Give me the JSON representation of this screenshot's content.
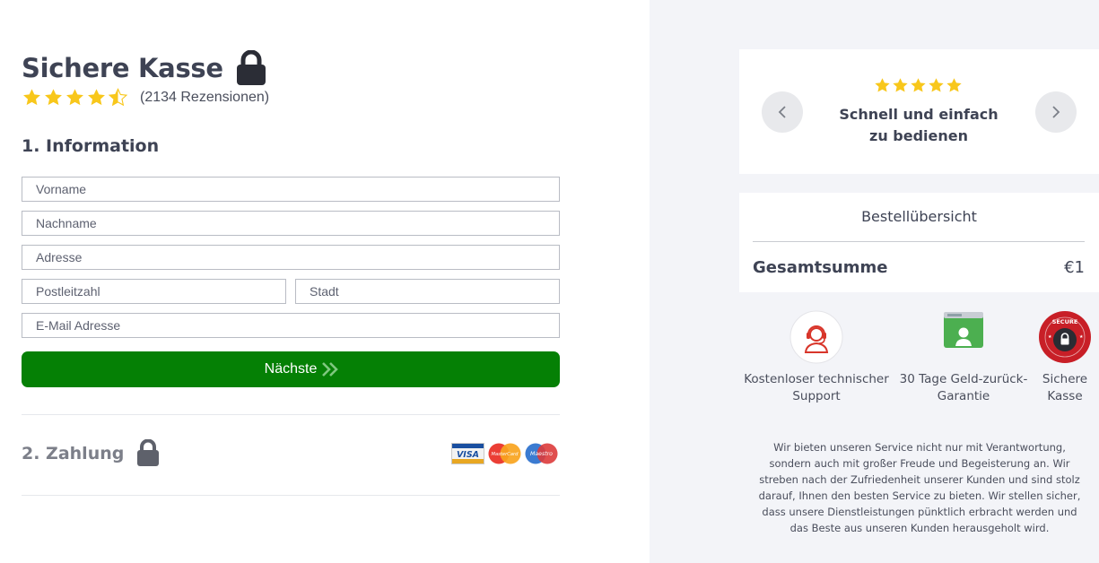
{
  "header": {
    "title": "Sichere Kasse",
    "rating_stars": 4.5,
    "reviews": "(2134 Rezensionen)"
  },
  "form": {
    "section_title": "1. Information",
    "fields": {
      "firstname_placeholder": "Vorname",
      "lastname_placeholder": "Nachname",
      "address_placeholder": "Adresse",
      "zip_placeholder": "Postleitzahl",
      "city_placeholder": "Stadt",
      "email_placeholder": "E-Mail Adresse"
    },
    "next_label": "Nächste"
  },
  "payment": {
    "section_title": "2. Zahlung",
    "cards": [
      "VISA",
      "MasterCard",
      "Maestro"
    ]
  },
  "testimonial": {
    "stars": 5,
    "text": "Schnell und einfach zu bedienen"
  },
  "summary": {
    "title": "Bestellübersicht",
    "total_label": "Gesamtsumme",
    "total_value": "€1"
  },
  "badges": [
    {
      "icon": "support-agent-icon",
      "label": "Kostenloser technischer Support"
    },
    {
      "icon": "money-back-icon",
      "label": "30 Tage Geld-zurück-Garantie"
    },
    {
      "icon": "secure-seal-icon",
      "label": "Sichere Kasse",
      "seal_text": "SECURE"
    }
  ],
  "about": "Wir bieten unseren Service nicht nur mit Verantwortung, sondern auch mit großer Freude und Begeisterung an. Wir streben nach der Zufriedenheit unserer Kunden und sind stolz darauf, Ihnen den besten Service zu bieten. Wir stellen sicher, dass unsere Dienstleistungen pünktlich erbracht werden und das Beste aus unseren Kunden herausgeholt wird.",
  "colors": {
    "primary_button": "#058005",
    "star": "#f8c71b",
    "heading": "#3e4354",
    "right_panel_bg": "#f3f4f8"
  }
}
